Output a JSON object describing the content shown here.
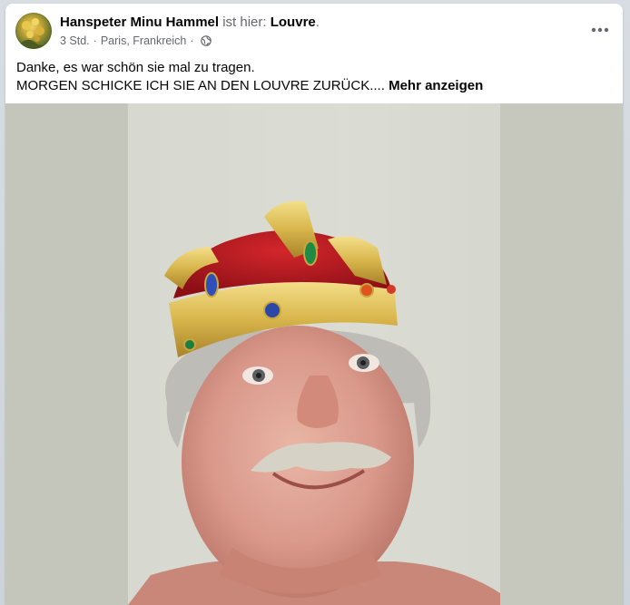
{
  "post": {
    "author_name": "Hanspeter Minu Hammel",
    "location_prefix": "ist hier: ",
    "location_name": "Louvre",
    "location_suffix": ".",
    "time": "3 Std.",
    "separator": "·",
    "place": "Paris, Frankreich",
    "audience_icon": "globe-icon",
    "more_icon": "more-horizontal-icon",
    "text_line_1": "Danke, es war schön sie mal zu tragen.",
    "text_line_2": "MORGEN SCHICKE ICH SIE AN DEN LOUVRE ZURÜCK....",
    "see_more_label": "Mehr anzeigen"
  },
  "colors": {
    "name": "#050505",
    "secondary": "#65676b",
    "card": "#ffffff",
    "photo_backdrop": "#c6c7bb"
  }
}
